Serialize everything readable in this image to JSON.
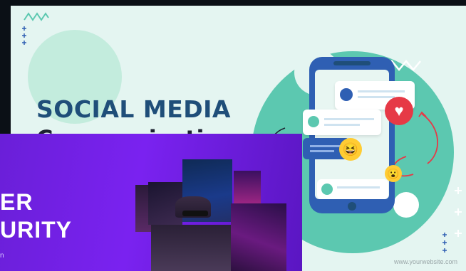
{
  "slide_social": {
    "title_line1": "SOCIAL MEDIA",
    "title_line2": "Communication",
    "website": "www.yourwebsite.com",
    "colors": {
      "bg": "#e4f5f1",
      "teal": "#5cc8b0",
      "title": "#1f4e79",
      "phone": "#2f5fb3"
    },
    "icons": [
      "zigzag-icon",
      "plus-icon",
      "heart-icon",
      "laughing-emoji-icon",
      "surprised-emoji-icon",
      "user-icon",
      "chat-bubble-icon"
    ]
  },
  "slide_cyber": {
    "title_line1": "ER",
    "title_line2": "URITY",
    "subtitle": "n",
    "colors": {
      "bg": "#6a1fd8"
    }
  }
}
